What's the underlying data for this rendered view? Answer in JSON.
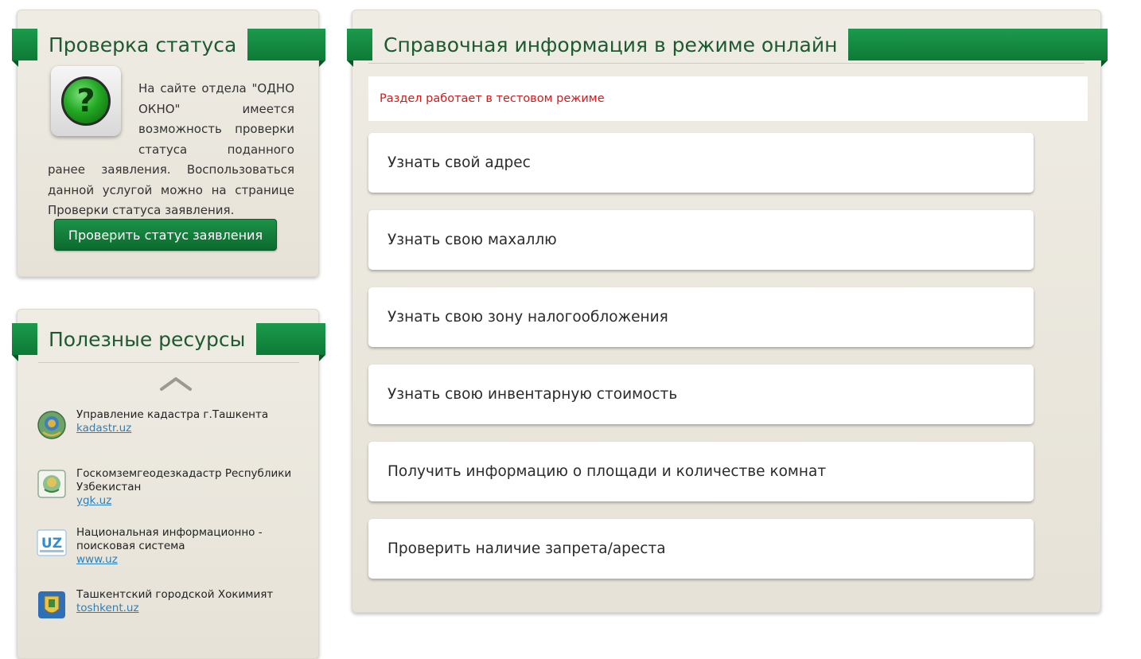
{
  "status_panel": {
    "title": "Проверка статуса",
    "description": "На сайте отдела \"ОДНО ОКНО\" имеется возможность проверки статуса поданного ранее заявления. Воспользоваться данной услугой можно на странице Проверки статуса заявления.",
    "icon": "question-icon",
    "button_label": "Проверить статус заявления"
  },
  "resources_panel": {
    "title": "Полезные ресурсы",
    "items": [
      {
        "name": "Управление кадастра г.Ташкента",
        "link": "kadastr.uz",
        "icon": "emblem-logo"
      },
      {
        "name": "Госкомземгеодезкадастр Республики Узбекистан",
        "link": "ygk.uz",
        "icon": "ygk-logo"
      },
      {
        "name": "Национальная информационно - поисковая система",
        "link": "www.uz",
        "icon": "uz-logo"
      },
      {
        "name": "Ташкентский городской Хокимият",
        "link": "toshkent.uz",
        "icon": "tashkent-logo"
      }
    ]
  },
  "main_panel": {
    "title": "Справочная информация в режиме онлайн",
    "notice": "Раздел работает в тестовом режиме",
    "items": [
      "Узнать свой адрес",
      "Узнать свою махаллю",
      "Узнать свою зону налогообложения",
      "Узнать свою инвентарную стоимость",
      "Получить информацию о площади и количестве комнат",
      "Проверить наличие запрета/ареста"
    ]
  },
  "colors": {
    "accent_green": "#0d7a36",
    "notice_red": "#d21a1a",
    "link_blue": "#2e7fb8",
    "panel_bg": "#e9e6dc"
  }
}
